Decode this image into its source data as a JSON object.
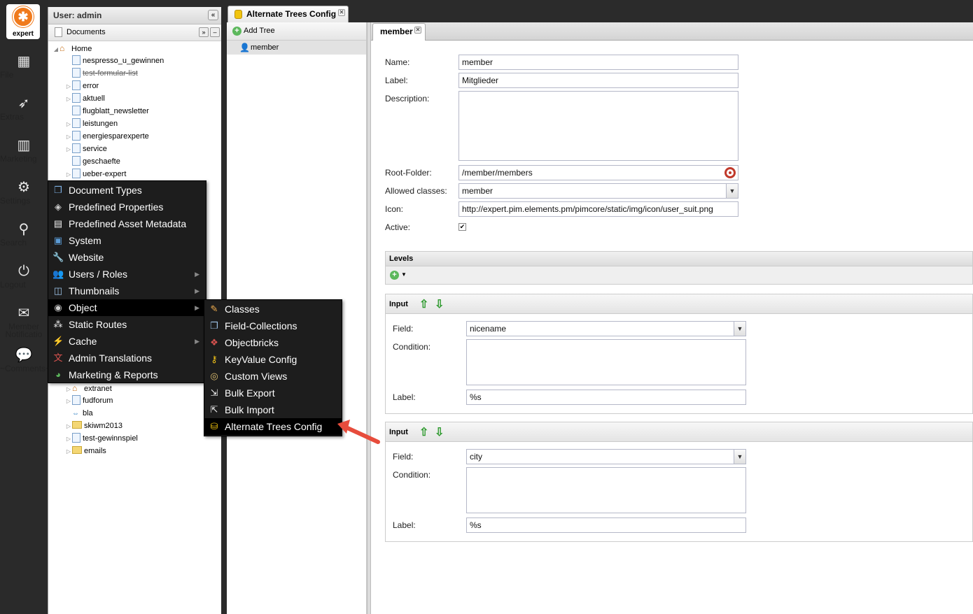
{
  "nav": {
    "logo_text": "expert",
    "items": [
      {
        "label": "File",
        "icon": "grid-icon"
      },
      {
        "label": "Extras",
        "icon": "rocket-icon"
      },
      {
        "label": "Marketing",
        "icon": "chart-icon"
      },
      {
        "label": "Settings",
        "icon": "gears-icon"
      },
      {
        "label": "Search",
        "icon": "search-icon"
      },
      {
        "label": "Logout",
        "icon": "logout-icon"
      },
      {
        "label": "Member Notificatio",
        "icon": "envelope-icon"
      },
      {
        "label": "~Comments~",
        "icon": "chat-icon"
      }
    ]
  },
  "tree_panel": {
    "title": "User: admin",
    "section": "Documents",
    "items": [
      {
        "label": "Home"
      },
      {
        "label": "nespresso_u_gewinnen"
      },
      {
        "label": "test-formular-list"
      },
      {
        "label": "error"
      },
      {
        "label": "aktuell"
      },
      {
        "label": "flugblatt_newsletter"
      },
      {
        "label": "leistungen"
      },
      {
        "label": "energiesparexperte"
      },
      {
        "label": "service"
      },
      {
        "label": "geschaefte"
      },
      {
        "label": "ueber-expert"
      },
      {
        "label": "extranet"
      },
      {
        "label": "fudforum"
      },
      {
        "label": "bla"
      },
      {
        "label": "skiwm2013"
      },
      {
        "label": "test-gewinnspiel"
      },
      {
        "label": "emails"
      }
    ]
  },
  "main_tab": {
    "label": "Alternate Trees Config"
  },
  "list_panel": {
    "add_label": "Add Tree",
    "items": [
      {
        "label": "member"
      }
    ]
  },
  "editor": {
    "tab_label": "member",
    "fields": {
      "name_label": "Name:",
      "name_value": "member",
      "label_label": "Label:",
      "label_value": "Mitglieder",
      "description_label": "Description:",
      "root_folder_label": "Root-Folder:",
      "root_folder_value": "/member/members",
      "allowed_classes_label": "Allowed classes:",
      "allowed_classes_value": "member",
      "icon_label": "Icon:",
      "icon_value": "http://expert.pim.elements.pm/pimcore/static/img/icon/user_suit.png",
      "active_label": "Active:",
      "active_checked": "✔"
    },
    "levels": {
      "title": "Levels",
      "inputs": [
        {
          "title": "Input",
          "field_label": "Field:",
          "field_value": "nicename",
          "condition_label": "Condition:",
          "label_label": "Label:",
          "label_value": "%s"
        },
        {
          "title": "Input",
          "field_label": "Field:",
          "field_value": "city",
          "condition_label": "Condition:",
          "label_label": "Label:",
          "label_value": "%s"
        }
      ]
    }
  },
  "settings_menu": {
    "items": [
      {
        "label": "Document Types"
      },
      {
        "label": "Predefined Properties"
      },
      {
        "label": "Predefined Asset Metadata"
      },
      {
        "label": "System"
      },
      {
        "label": "Website"
      },
      {
        "label": "Users / Roles"
      },
      {
        "label": "Thumbnails"
      },
      {
        "label": "Object"
      },
      {
        "label": "Static Routes"
      },
      {
        "label": "Cache"
      },
      {
        "label": "Admin Translations"
      },
      {
        "label": "Marketing & Reports"
      }
    ]
  },
  "object_submenu": {
    "items": [
      {
        "label": "Classes"
      },
      {
        "label": "Field-Collections"
      },
      {
        "label": "Objectbricks"
      },
      {
        "label": "KeyValue Config"
      },
      {
        "label": "Custom Views"
      },
      {
        "label": "Bulk Export"
      },
      {
        "label": "Bulk Import"
      },
      {
        "label": "Alternate Trees Config"
      }
    ]
  },
  "colors": {
    "menu_bg": "#1d1d1d",
    "accent_red": "#e74c3c",
    "green": "#2f9a2f"
  }
}
